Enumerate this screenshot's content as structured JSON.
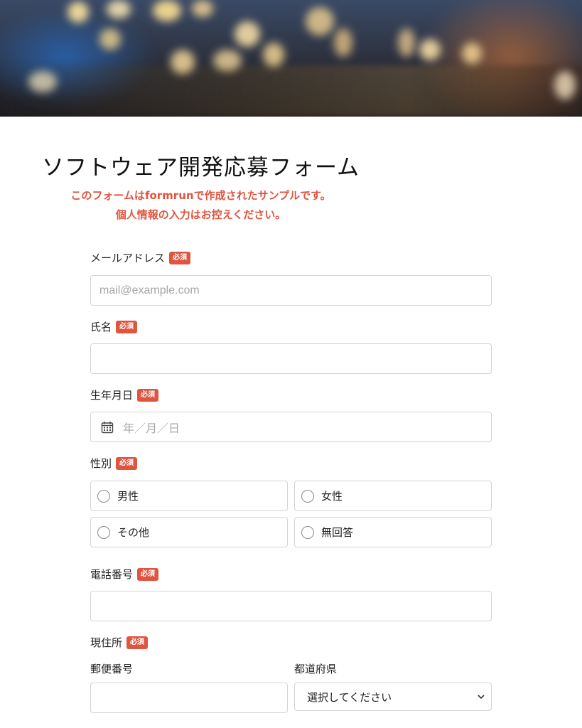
{
  "form": {
    "title": "ソフトウェア開発応募フォーム",
    "notice_line1_pre": "このフォームは",
    "notice_brand": "formrun",
    "notice_line1_post": "で作成されたサンプルです。",
    "notice_line2": "個人情報の入力はお控えください。",
    "required_badge": "必須"
  },
  "fields": {
    "email": {
      "label": "メールアドレス",
      "placeholder": "mail@example.com",
      "value": ""
    },
    "name": {
      "label": "氏名",
      "value": ""
    },
    "birthdate": {
      "label": "生年月日",
      "placeholder": "年／月／日",
      "icon": "calendar-icon"
    },
    "gender": {
      "label": "性別",
      "options": [
        "男性",
        "女性",
        "その他",
        "無回答"
      ]
    },
    "phone": {
      "label": "電話番号",
      "value": ""
    },
    "address": {
      "label": "現住所",
      "postal_label": "郵便番号",
      "prefecture_label": "都道府県",
      "prefecture_selected": "選択してください"
    }
  },
  "colors": {
    "accent": "#e0553f",
    "border": "#d4d4d4",
    "placeholder": "#a6a6a6"
  }
}
